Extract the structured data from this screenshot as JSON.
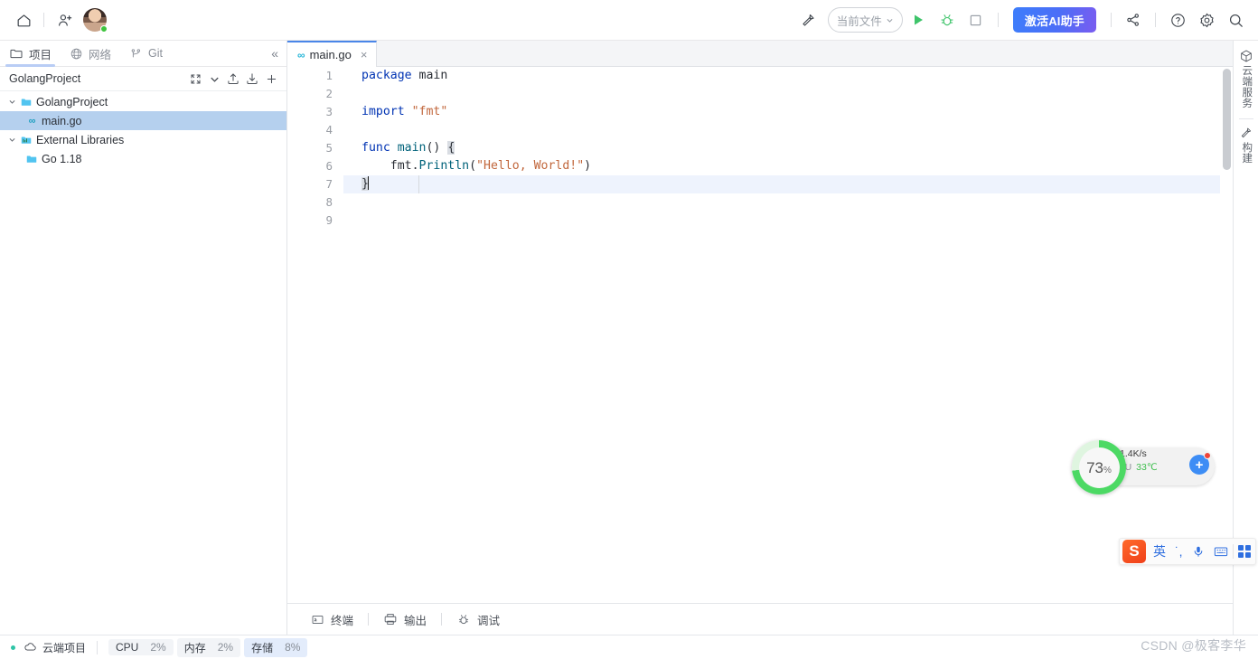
{
  "topbar": {
    "home_icon": "home-icon",
    "add_user_icon": "add-user-icon",
    "avatar_icon": "avatar",
    "hammer_icon": "build-hammer-icon",
    "run_config": "当前文件",
    "run_icon": "run-icon",
    "debug_icon": "debug-icon",
    "stop_icon": "stop-icon",
    "ai_button": "激活AI助手",
    "share_icon": "share-icon",
    "help_icon": "help-icon",
    "settings_icon": "settings-icon",
    "search_icon": "search-icon"
  },
  "left_tabs": [
    {
      "label": "项目",
      "icon": "folder-icon",
      "active": true
    },
    {
      "label": "网络",
      "icon": "globe-icon",
      "active": false
    },
    {
      "label": "Git",
      "icon": "git-branch-icon",
      "active": false
    }
  ],
  "collapse_label": "«",
  "project_panel": {
    "title": "GolangProject",
    "tools": [
      "expand-collapse-icon",
      "chevron-down-icon",
      "upload-icon",
      "download-icon",
      "plus-icon"
    ],
    "tree": [
      {
        "label": "GolangProject",
        "icon": "folder-icon",
        "depth": 0,
        "expanded": true,
        "selected": false
      },
      {
        "label": "main.go",
        "icon": "go-file-icon",
        "depth": 1,
        "expanded": null,
        "selected": true
      },
      {
        "label": "External Libraries",
        "icon": "library-icon",
        "depth": 0,
        "expanded": true,
        "selected": false
      },
      {
        "label": "Go 1.18",
        "icon": "folder-icon",
        "depth": 1,
        "expanded": null,
        "selected": false
      }
    ]
  },
  "editor": {
    "tab": {
      "label": "main.go",
      "icon": "go-file-icon",
      "close": "×"
    },
    "line_numbers": [
      "1",
      "2",
      "3",
      "4",
      "5",
      "6",
      "7",
      "8",
      "9"
    ],
    "lines": [
      {
        "n": 1,
        "text": "package main"
      },
      {
        "n": 2,
        "text": ""
      },
      {
        "n": 3,
        "text": "import \"fmt\""
      },
      {
        "n": 4,
        "text": ""
      },
      {
        "n": 5,
        "text": "func main() {"
      },
      {
        "n": 6,
        "text": "    fmt.Println(\"Hello, World!\")"
      },
      {
        "n": 7,
        "text": "}"
      },
      {
        "n": 8,
        "text": ""
      },
      {
        "n": 9,
        "text": ""
      }
    ],
    "caret_line": 7,
    "tokens": {
      "kw_package": "package",
      "id_main": "main",
      "kw_import": "import",
      "str_fmt": "\"fmt\"",
      "kw_func": "func",
      "fn_main": "main",
      "parens": "()",
      "brace_open": "{",
      "pkg_fmt": "fmt",
      "dot": ".",
      "fn_println": "Println",
      "str_hello": "\"Hello, World!\"",
      "brace_close": "}"
    }
  },
  "right_strip": [
    {
      "label": "云端服务",
      "icon": "cube-icon"
    },
    {
      "label": "构建",
      "icon": "hammer-icon"
    }
  ],
  "bottom_bar": [
    {
      "label": "终端",
      "icon": "terminal-icon"
    },
    {
      "label": "输出",
      "icon": "output-icon"
    },
    {
      "label": "调试",
      "icon": "debug-icon"
    }
  ],
  "statusbar": {
    "cloud_project": "云端项目",
    "cloud_icon": "cloud-icon",
    "metrics": [
      {
        "key": "CPU",
        "value": "2%",
        "highlight": false
      },
      {
        "key": "内存",
        "value": "2%",
        "highlight": false
      },
      {
        "key": "存储",
        "value": "8%",
        "highlight": true
      }
    ],
    "watermark": "CSDN @极客李华"
  },
  "perf_widget": {
    "percent": "73",
    "percent_symbol": "%",
    "percent_value": 73,
    "net_arrow": "↓",
    "net_speed": "1.4K/s",
    "cpu_label": "CPU",
    "cpu_temp": "33℃",
    "badge": "+"
  },
  "ime": {
    "logo": "S",
    "mode": "英",
    "punct": "˙,",
    "mic_icon": "microphone-icon",
    "keyboard_icon": "keyboard-icon",
    "apps_icon": "apps-grid-icon"
  },
  "colors": {
    "accent_blue": "#4a86e8",
    "ai_gradient_start": "#3d7dfb",
    "ai_gradient_end": "#7a5cf0",
    "run_green": "#3ec46a",
    "selection_blue": "#b5d0ee",
    "keyword_blue": "#0033b3",
    "string_orange": "#c1663b",
    "func_teal": "#00627a",
    "perf_green": "#4cd964"
  }
}
